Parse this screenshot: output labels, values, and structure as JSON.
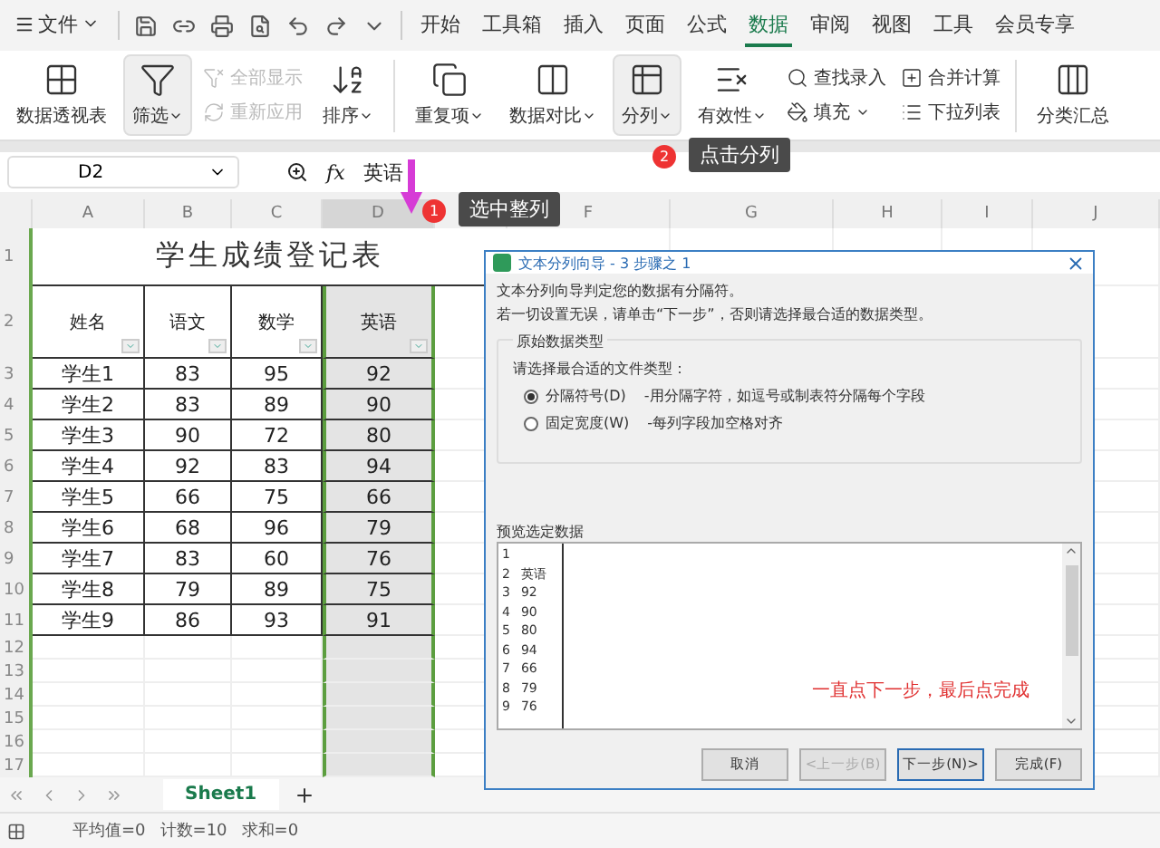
{
  "menu_bar": {
    "file": "文件",
    "tabs": [
      {
        "label": "开始",
        "selected": false
      },
      {
        "label": "工具箱",
        "selected": false
      },
      {
        "label": "插入",
        "selected": false
      },
      {
        "label": "页面",
        "selected": false
      },
      {
        "label": "公式",
        "selected": false
      },
      {
        "label": "数据",
        "selected": true
      },
      {
        "label": "审阅",
        "selected": false
      },
      {
        "label": "视图",
        "selected": false
      },
      {
        "label": "工具",
        "selected": false
      },
      {
        "label": "会员专享",
        "selected": false
      }
    ]
  },
  "ribbon": [
    {
      "kind": "big",
      "label": "数据透视表",
      "highlighted": false
    },
    {
      "kind": "big",
      "label": "筛选",
      "caret": true,
      "highlighted": true
    },
    {
      "kind": "stack",
      "items": [
        {
          "label": "全部显示",
          "disabled": true
        },
        {
          "label": "重新应用",
          "disabled": true
        }
      ]
    },
    {
      "kind": "big",
      "label": "排序",
      "caret": true,
      "highlighted": false
    },
    {
      "kind": "divider"
    },
    {
      "kind": "big",
      "label": "重复项",
      "caret": true,
      "highlighted": false
    },
    {
      "kind": "big",
      "label": "数据对比",
      "caret": true,
      "highlighted": false
    },
    {
      "kind": "big",
      "label": "分列",
      "caret": true,
      "highlighted": true
    },
    {
      "kind": "big",
      "label": "有效性",
      "caret": true,
      "highlighted": false
    },
    {
      "kind": "stack",
      "items": [
        {
          "label": "查找录入",
          "disabled": false
        },
        {
          "label": "填充",
          "disabled": false,
          "caret": true
        }
      ]
    },
    {
      "kind": "stack",
      "items": [
        {
          "label": "合并计算",
          "disabled": false
        },
        {
          "label": "下拉列表",
          "disabled": false
        }
      ]
    },
    {
      "kind": "divider"
    },
    {
      "kind": "big",
      "label": "分类汇总",
      "highlighted": false
    }
  ],
  "formula_bar": {
    "cell": "D2",
    "fx": "fx",
    "value": "英语"
  },
  "sheet": {
    "columns": [
      {
        "label": "A",
        "selected": false
      },
      {
        "label": "B",
        "selected": false
      },
      {
        "label": "C",
        "selected": false
      },
      {
        "label": "D",
        "selected": true
      },
      {
        "selected": false
      },
      {
        "label": "F",
        "selected": false
      },
      {
        "label": "G",
        "selected": false
      },
      {
        "label": "H",
        "selected": false
      },
      {
        "label": "I",
        "selected": false
      },
      {
        "label": "J",
        "selected": false
      }
    ],
    "row_numbers": [
      "1",
      "2",
      "3",
      "4",
      "5",
      "6",
      "7",
      "8",
      "9",
      "10",
      "11",
      "12",
      "13",
      "14",
      "15",
      "16",
      "17"
    ],
    "title": "学生成绩登记表",
    "headers": [
      "姓名",
      "语文",
      "数学",
      "英语"
    ],
    "rows": [
      [
        "学生1",
        "83",
        "95",
        "92"
      ],
      [
        "学生2",
        "83",
        "89",
        "90"
      ],
      [
        "学生3",
        "90",
        "72",
        "80"
      ],
      [
        "学生4",
        "92",
        "83",
        "94"
      ],
      [
        "学生5",
        "66",
        "75",
        "66"
      ],
      [
        "学生6",
        "68",
        "96",
        "79"
      ],
      [
        "学生7",
        "83",
        "60",
        "76"
      ],
      [
        "学生8",
        "79",
        "89",
        "75"
      ],
      [
        "学生9",
        "86",
        "93",
        "91"
      ]
    ]
  },
  "annotations": [
    {
      "badge": "1",
      "text": "选中整列"
    },
    {
      "badge": "2",
      "text": "点击分列"
    }
  ],
  "dialog": {
    "title": "文本分列向导 - 3 步骤之 1",
    "intro": [
      "文本分列向导判定您的数据有分隔符。",
      "若一切设置无误，请单击“下一步”，否则请选择最合适的数据类型。"
    ],
    "group_title": "原始数据类型",
    "prompt": "请选择最合适的文件类型：",
    "options": [
      {
        "label": "分隔符号(D)",
        "description": "-用分隔字符，如逗号或制表符分隔每个字段",
        "selected": true
      },
      {
        "label": "固定宽度(W)",
        "description": "-每列字段加空格对齐",
        "selected": false
      }
    ],
    "preview_title": "预览选定数据",
    "preview": [
      {
        "n": "1"
      },
      {
        "n": "2",
        "v": "英语"
      },
      {
        "n": "3",
        "v": "92"
      },
      {
        "n": "4",
        "v": "90"
      },
      {
        "n": "5",
        "v": "80"
      },
      {
        "n": "6",
        "v": "94"
      },
      {
        "n": "7",
        "v": "66"
      },
      {
        "n": "8",
        "v": "79"
      },
      {
        "n": "9",
        "v": "76"
      }
    ],
    "note": "一直点下一步，最后点完成",
    "buttons": [
      {
        "label": "取消",
        "disabled": false,
        "focused": false
      },
      {
        "label": "<上一步(B)",
        "disabled": true,
        "focused": false
      },
      {
        "label": "下一步(N)>",
        "disabled": false,
        "focused": true
      },
      {
        "label": "完成(F)",
        "disabled": false,
        "focused": false
      }
    ]
  },
  "sheet_tabs": [
    {
      "label": "Sheet1",
      "selected": true
    }
  ],
  "status_bar": [
    "平均值=0",
    "计数=10",
    "求和=0"
  ]
}
